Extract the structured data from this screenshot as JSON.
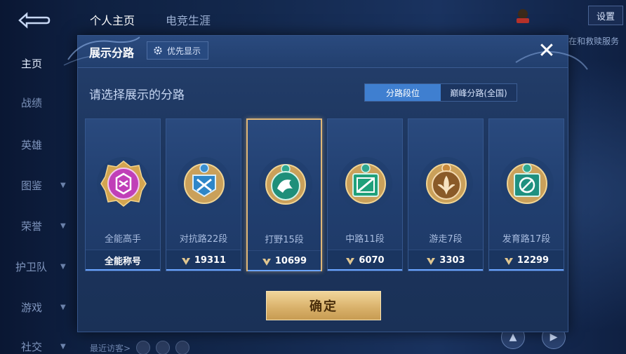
{
  "nav": {
    "items": [
      {
        "label": "主页",
        "active": true
      },
      {
        "label": "战绩",
        "active": false
      },
      {
        "label": "英雄",
        "active": false
      },
      {
        "label": "图鉴",
        "active": false
      },
      {
        "label": "荣誉",
        "active": false
      },
      {
        "label": "护卫队",
        "active": false
      },
      {
        "label": "游戏",
        "active": false
      },
      {
        "label": "社交",
        "active": false
      }
    ]
  },
  "top_tabs": [
    "个人主页",
    "电竞生涯"
  ],
  "settings_label": "设置",
  "right_text": "在和救赎服务",
  "visitors_label": "最近访客>",
  "dialog": {
    "title": "展示分路",
    "priority_label": "优先显示",
    "close_label": "✕",
    "subtitle": "请选择展示的分路",
    "segments": [
      "分路段位",
      "巅峰分路(全国)"
    ],
    "active_segment": 0,
    "cards": [
      {
        "name": "全能高手",
        "stat": "",
        "foot": "全能称号",
        "badge": "all-round-badge-icon",
        "color": "#c03fb8"
      },
      {
        "name": "对抗路22段",
        "stat": "19311",
        "foot": "",
        "badge": "clash-lane-badge-icon",
        "color": "#2e86c8"
      },
      {
        "name": "打野15段",
        "stat": "10699",
        "foot": "",
        "badge": "jungle-badge-icon",
        "color": "#1f8f7a",
        "selected": true
      },
      {
        "name": "中路11段",
        "stat": "6070",
        "foot": "",
        "badge": "mid-lane-badge-icon",
        "color": "#1fa07a"
      },
      {
        "name": "游走7段",
        "stat": "3303",
        "foot": "",
        "badge": "roam-badge-icon",
        "color": "#8a5a28"
      },
      {
        "name": "发育路17段",
        "stat": "12299",
        "foot": "",
        "badge": "farm-lane-badge-icon",
        "color": "#1f9080"
      }
    ],
    "confirm_label": "确定"
  },
  "colors": {
    "accent_gold": "#e0b777",
    "tab_active": "#3f7fd0"
  }
}
